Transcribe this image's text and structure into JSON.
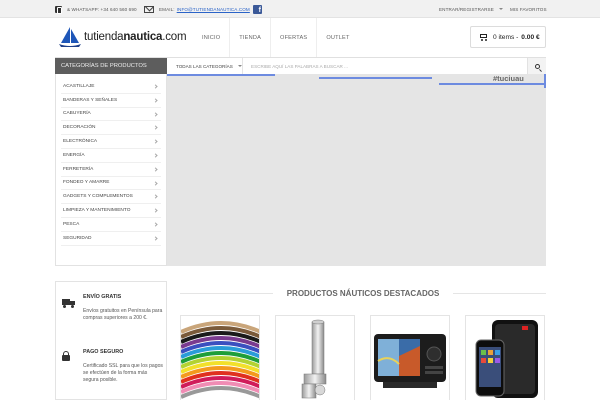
{
  "topbar": {
    "whatsapp_label": "& WhatsApp: +34 640 560 690",
    "email_label": "Email:",
    "email_value": "info@tutiendanautica.com",
    "login_label": "Entrar/Registrarse",
    "favorites_label": "Mis favoritos"
  },
  "header": {
    "logo_text_a": "tienda",
    "logo_text_b": "nautica",
    "logo_text_c": ".com",
    "logo_prefix": "tu",
    "nav": [
      "Inicio",
      "Tienda",
      "Ofertas",
      "Outlet"
    ],
    "cart_items": "0 items",
    "cart_total": "0.00 €"
  },
  "search": {
    "categories_title": "Categorías de productos",
    "select_value": "Todas las categorías",
    "placeholder": "Escribe aquí las palabras a buscar ..."
  },
  "sidebar": {
    "items": [
      "Acastillaje",
      "Banderas y señales",
      "Cabuyería",
      "Decoración",
      "Electrónica",
      "Energía",
      "Ferretería",
      "Fondeo y amarre",
      "Gadgets y complementos",
      "Limpieza y mantenimiento",
      "Pesca",
      "Seguridad"
    ]
  },
  "slider": {
    "text": "#tuciuau"
  },
  "features": [
    {
      "title": "Envío gratis",
      "text": "Envíos gratuitos en Península para compras superiores a 200 €.",
      "icon": "truck-icon"
    },
    {
      "title": "Pago seguro",
      "text": "Certificado SSL para que los pagos se efectúen de la forma más segura posible.",
      "icon": "lock-icon"
    }
  ],
  "products": {
    "title": "Productos náuticos destacados",
    "items": [
      "rope-product",
      "rod-holder-product",
      "fishfinder-product",
      "satellite-phone-product"
    ]
  },
  "colors": {
    "brand_blue": "#2a63c8",
    "accent": "#6d8be0",
    "category_bar": "#5d5d5d",
    "facebook": "#3b5998"
  }
}
